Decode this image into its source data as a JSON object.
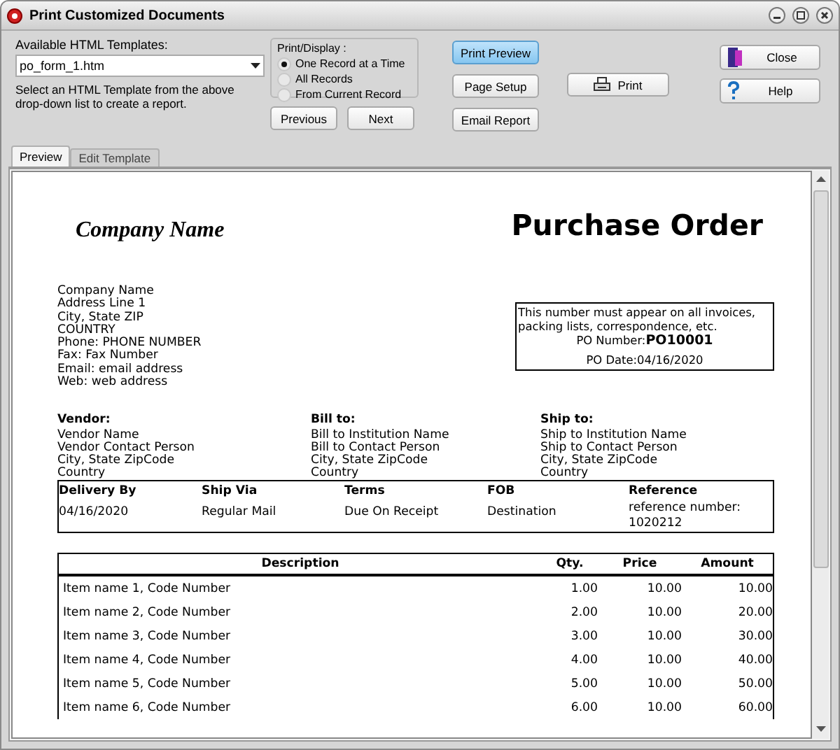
{
  "window": {
    "title": "Print Customized Documents"
  },
  "template_picker": {
    "label": "Available HTML Templates:",
    "value": "po_form_1.htm",
    "hint": "Select an HTML Template from the above drop-down list to create a report."
  },
  "print_display": {
    "legend": "Print/Display :",
    "options": [
      {
        "label": "One Record at a Time",
        "selected": true
      },
      {
        "label": "All Records",
        "selected": false
      },
      {
        "label": "From Current Record",
        "selected": false
      }
    ]
  },
  "nav_buttons": [
    "Previous",
    "Next"
  ],
  "action_buttons": [
    {
      "label": "Print Preview",
      "kind": "default"
    },
    {
      "label": "Page Setup",
      "kind": "plain"
    },
    {
      "label": "Email Report",
      "kind": "plain"
    }
  ],
  "print_button": "Print",
  "side_buttons": [
    {
      "label": "Close",
      "kind": "close"
    },
    {
      "label": "Help",
      "kind": "help"
    }
  ],
  "tabs": [
    {
      "label": "Preview",
      "selected": true
    },
    {
      "label": "Edit Template",
      "selected": false
    }
  ],
  "document": {
    "company_name": "Company Name",
    "title": "Purchase Order",
    "company_address": [
      "Company Name",
      "Address Line 1",
      "City, State ZIP",
      "COUNTRY",
      "Phone: PHONE NUMBER",
      "Fax: Fax Number",
      "Email: email address",
      "Web: web address"
    ],
    "po_box": {
      "note": "This number must appear on all invoices, packing lists, correspondence, etc.",
      "po_number_label": "PO Number:",
      "po_number": "PO10001",
      "po_date_label": "PO Date:",
      "po_date": "04/16/2020"
    },
    "parties": [
      {
        "heading": "Vendor:",
        "lines": [
          "Vendor Name",
          "Vendor Contact Person",
          "City, State ZipCode",
          "Country"
        ]
      },
      {
        "heading": "Bill to:",
        "lines": [
          "Bill to Institution Name",
          "Bill to Contact Person",
          "City, State ZipCode",
          "Country"
        ]
      },
      {
        "heading": "Ship to:",
        "lines": [
          "Ship to Institution Name",
          "Ship to Contact Person",
          "City, State ZipCode",
          "Country"
        ]
      }
    ],
    "order_info": [
      {
        "heading": "Delivery By",
        "value": "04/16/2020"
      },
      {
        "heading": "Ship Via",
        "value": "Regular Mail"
      },
      {
        "heading": "Terms",
        "value": "Due On Receipt"
      },
      {
        "heading": "FOB",
        "value": "Destination"
      },
      {
        "heading": "Reference",
        "value": "reference number: 1020212"
      }
    ],
    "items": {
      "columns": [
        "Description",
        "Qty.",
        "Price",
        "Amount"
      ],
      "rows": [
        [
          "Item name 1, Code Number",
          "1.00",
          "10.00",
          "10.00"
        ],
        [
          "Item name 2, Code Number",
          "2.00",
          "10.00",
          "20.00"
        ],
        [
          "Item name 3, Code Number",
          "3.00",
          "10.00",
          "30.00"
        ],
        [
          "Item name 4, Code Number",
          "4.00",
          "10.00",
          "40.00"
        ],
        [
          "Item name 5, Code Number",
          "5.00",
          "10.00",
          "50.00"
        ],
        [
          "Item name 6, Code Number",
          "6.00",
          "10.00",
          "60.00"
        ]
      ]
    }
  }
}
